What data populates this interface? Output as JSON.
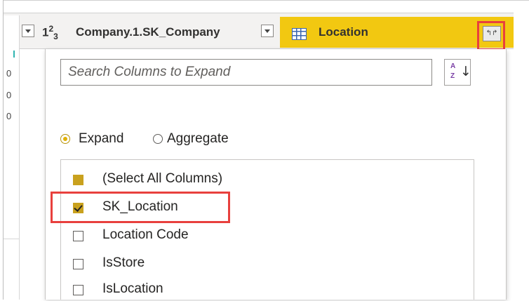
{
  "header": {
    "column1_type_base": "1",
    "column1_type_sup": "2",
    "column1_type_sub": "3",
    "column1_title": "Company.1.SK_Company",
    "column2_title": "Location",
    "expand_button_symbol": "↰↱"
  },
  "grid_fragments": [
    "0",
    "0",
    "0"
  ],
  "expand_panel": {
    "search_placeholder": "Search Columns to Expand",
    "sort_icon_az": "A\nZ",
    "sort_icon_arrow": "↓",
    "modes": [
      {
        "label": "Expand",
        "selected": true
      },
      {
        "label": "Aggregate",
        "selected": false
      }
    ],
    "columns": [
      {
        "label": "(Select All Columns)",
        "state": "partial"
      },
      {
        "label": "SK_Location",
        "state": "checked"
      },
      {
        "label": "Location Code",
        "state": "unchecked"
      },
      {
        "label": "IsStore",
        "state": "unchecked"
      },
      {
        "label": "IsLocation",
        "state": "unchecked"
      }
    ]
  },
  "colors": {
    "location_header_bg": "#f2c811",
    "checkbox_fill": "#c9a11e",
    "highlight_border": "#e8403d",
    "table_icon": "#3b66b1"
  }
}
